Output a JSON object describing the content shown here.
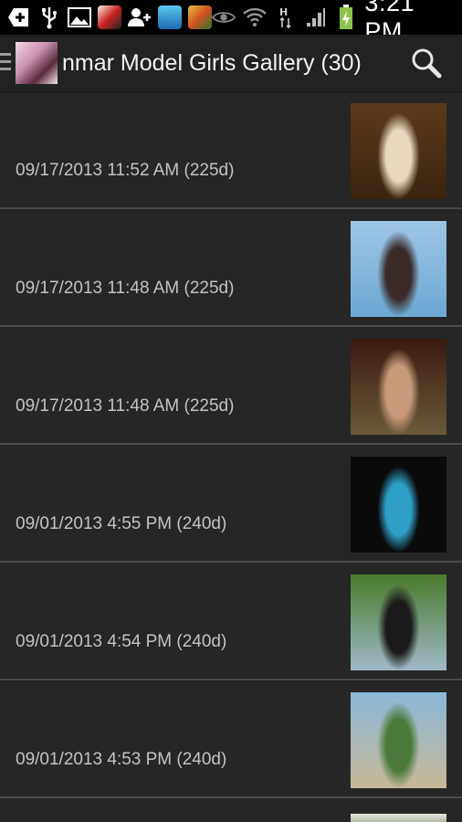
{
  "status_bar": {
    "time": "3:21 PM",
    "icons": [
      "add-icon",
      "usb-icon",
      "image-icon",
      "app-icon",
      "add-user-icon",
      "app-icon",
      "game-icon",
      "eye-icon",
      "wifi-icon",
      "network-h-icon",
      "signal-icon",
      "battery-charging-icon"
    ]
  },
  "header": {
    "title": "nmar Model Girls Gallery (30)",
    "search_icon": "search-icon"
  },
  "gallery": {
    "items": [
      {
        "date": "09/17/2013 11:52 AM (225d)",
        "thumb_colors": [
          "#5a3a1a",
          "#e8d8c0",
          "#3a2410"
        ]
      },
      {
        "date": "09/17/2013 11:48 AM (225d)",
        "thumb_colors": [
          "#9ec6e6",
          "#3a2a28",
          "#6ba8d4"
        ]
      },
      {
        "date": "09/17/2013 11:48 AM (225d)",
        "thumb_colors": [
          "#3a1a10",
          "#c99a7a",
          "#6a5a3a"
        ]
      },
      {
        "date": "09/01/2013 4:55 PM (240d)",
        "thumb_colors": [
          "#0a0a0a",
          "#2ea0c8",
          "#0a0a0a"
        ]
      },
      {
        "date": "09/01/2013 4:54 PM (240d)",
        "thumb_colors": [
          "#4a7a2a",
          "#1a1a1a",
          "#a0b8c8"
        ]
      },
      {
        "date": "09/01/2013 4:53 PM (240d)",
        "thumb_colors": [
          "#8ab8d8",
          "#4a7a3a",
          "#c8b898"
        ]
      }
    ]
  },
  "colors": {
    "background": "#262626",
    "divider": "#4a4a4a",
    "status_bar": "#000000",
    "battery": "#8bc34a"
  }
}
